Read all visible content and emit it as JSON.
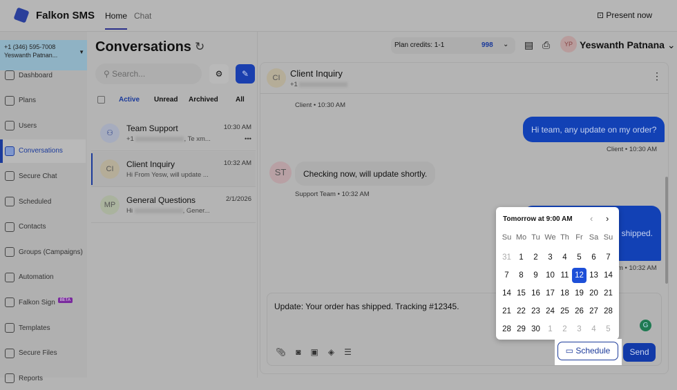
{
  "app": {
    "name": "Falkon SMS",
    "tabs": [
      "Home",
      "Chat"
    ],
    "present": "Present now"
  },
  "account": {
    "phone": "+1 (346) 595-7008",
    "name": "Yeswanth Patnan..."
  },
  "sidebar": [
    {
      "label": "Dashboard"
    },
    {
      "label": "Plans"
    },
    {
      "label": "Users"
    },
    {
      "label": "Conversations"
    },
    {
      "label": "Secure Chat"
    },
    {
      "label": "Scheduled"
    },
    {
      "label": "Contacts"
    },
    {
      "label": "Groups (Campaigns)"
    },
    {
      "label": "Automation"
    },
    {
      "label": "Falkon Sign",
      "badge": "BETA"
    },
    {
      "label": "Templates"
    },
    {
      "label": "Secure Files"
    },
    {
      "label": "Reports"
    }
  ],
  "conversations": {
    "title": "Conversations",
    "search_placeholder": "Search...",
    "filters": [
      "Active",
      "Unread",
      "Archived",
      "All"
    ],
    "items": [
      {
        "initials": "",
        "name": "Team Support",
        "preview_prefix": "+1",
        "preview_suffix": ", Te xm...",
        "time": "10:30 AM",
        "more": "•••"
      },
      {
        "initials": "CI",
        "name": "Client Inquiry",
        "preview": "Hi From Yesw, will update ...",
        "time": "10:32 AM"
      },
      {
        "initials": "MP",
        "name": "General Questions",
        "preview_prefix": "Hi",
        "preview_suffix": ", Gener...",
        "time": "2/1/2026"
      }
    ]
  },
  "header": {
    "plan_label": "Plan credits: 1-1",
    "credits": "998",
    "user_initials": "YP",
    "user_name": "Yeswanth Patnana"
  },
  "chat": {
    "initials": "CI",
    "name": "Client Inquiry",
    "phone_prefix": "+1",
    "messages": [
      {
        "meta": "Client • 10:30 AM"
      },
      {
        "text": "Hi team, any update on my order?",
        "meta": "Client • 10:30 AM"
      },
      {
        "initials": "ST",
        "text": "Checking now, will update shortly.",
        "meta": "Support Team • 10:32 AM"
      },
      {
        "text": "shipped.",
        "meta": "m • 10:32 AM"
      }
    ],
    "draft": "Update: Your order has shipped. Tracking #12345.",
    "schedule": "Schedule",
    "send": "Send"
  },
  "calendar": {
    "title": "Tomorrow at 9:00 AM",
    "days": [
      "Su",
      "Mo",
      "Tu",
      "We",
      "Th",
      "Fr",
      "Sa",
      "Su"
    ],
    "weeks": [
      [
        "31",
        "1",
        "2",
        "3",
        "4",
        "5",
        "6",
        "7"
      ],
      [
        "7",
        "8",
        "9",
        "10",
        "11",
        "12",
        "13",
        "14"
      ],
      [
        "14",
        "15",
        "16",
        "17",
        "18",
        "19",
        "20",
        "21"
      ],
      [
        "21",
        "22",
        "23",
        "24",
        "25",
        "26",
        "27",
        "28"
      ],
      [
        "28",
        "29",
        "30",
        "1",
        "2",
        "3",
        "4",
        "5"
      ]
    ],
    "selected": "12"
  },
  "colors": {
    "accent": "#1d4fd8",
    "outgoing": "#1241b5"
  }
}
